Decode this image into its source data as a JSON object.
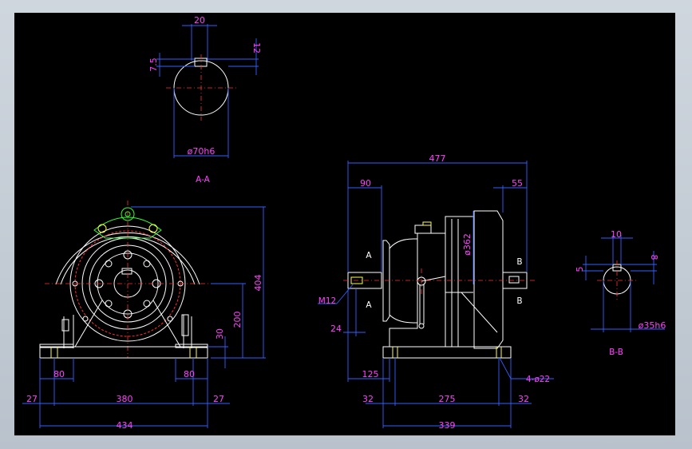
{
  "drawing": {
    "section_aa": {
      "title": "A-A",
      "dims": {
        "key_width": "20",
        "key_depth": "7.5",
        "key_height": "12",
        "shaft_dia": "ø70h6"
      }
    },
    "front_view": {
      "dims": {
        "height_total": "404",
        "center_height": "200",
        "base_thickness": "30",
        "foot_left": "80",
        "foot_right": "80",
        "edge_left": "27",
        "hole_span": "380",
        "edge_right": "27",
        "overall_width": "434"
      }
    },
    "side_view": {
      "dims": {
        "overall_length": "477",
        "shaft_out": "90",
        "shaft_in": "55",
        "flange_dia": "ø362",
        "shaft_tip": "24",
        "base_offset": "125",
        "foot_edge_left": "32",
        "foot_span": "275",
        "foot_edge_right": "32",
        "base_length": "339"
      },
      "labels": {
        "thread": "M12",
        "holes": "4-ø22",
        "sec_a_top": "A",
        "sec_a_bot": "A",
        "sec_b_top": "B",
        "sec_b_bot": "B"
      }
    },
    "section_bb": {
      "title": "B-B",
      "dims": {
        "key_width": "10",
        "key_depth": "5",
        "key_height": "8",
        "shaft_dia": "ø35h6"
      }
    }
  }
}
